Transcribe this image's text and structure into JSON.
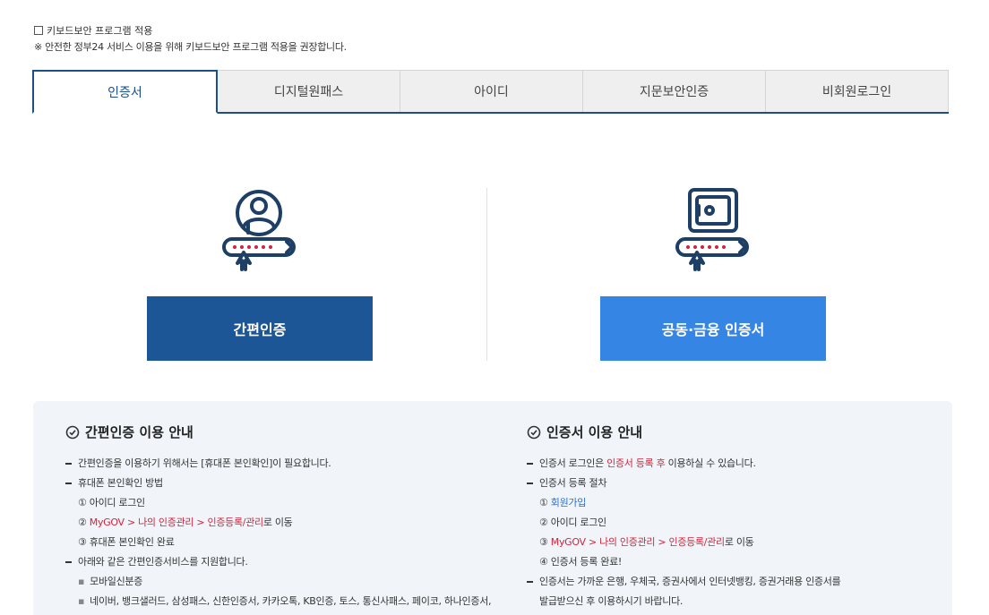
{
  "keyboard_security": {
    "checkbox_label": "키보드보안 프로그램 적용",
    "note": "※ 안전한 정부24 서비스 이용을 위해 키보드보안 프로그램 적용을 권장합니다."
  },
  "tabs": [
    {
      "label": "인증서",
      "active": true
    },
    {
      "label": "디지털원패스",
      "active": false
    },
    {
      "label": "아이디",
      "active": false
    },
    {
      "label": "지문보안인증",
      "active": false
    },
    {
      "label": "비회원로그인",
      "active": false
    }
  ],
  "login_options": {
    "simple_auth_button": "간편인증",
    "cert_button": "공동·금융 인증서"
  },
  "colors": {
    "primary": "#1c5696",
    "cert_button": "#3585e4",
    "highlight": "#d2233c"
  },
  "guide_simple": {
    "title": "간편인증 이용 안내",
    "item1": "간편인증을 이용하기 위해서는 [휴대폰 본인확인]이 필요합니다.",
    "item2": "휴대폰 본인확인 방법",
    "step1": "① 아이디 로그인",
    "step2_prefix": "② ",
    "step2_link": "MyGOV > 나의 인증관리 > 인증등록/관리",
    "step2_suffix": "로 이동",
    "step3": "③ 휴대폰 본인확인 완료",
    "item3": "아래와 같은 간편인증서비스를 지원합니다.",
    "sub1": "모바일신분증",
    "sub2": "네이버, 뱅크샐러드, 삼성패스, 신한인증서, 카카오톡, KB인증, 토스, 통신사패스, 페이코, 하나인증서,"
  },
  "guide_cert": {
    "title": "인증서 이용 안내",
    "item1_prefix": "인증서 로그인은 ",
    "item1_highlight": "인증서 등록 후",
    "item1_suffix": " 이용하실 수 있습니다.",
    "item2": "인증서 등록 절차",
    "step1_prefix": "① ",
    "step1_link": "회원가입",
    "step2": "② 아이디 로그인",
    "step3_prefix": "③ ",
    "step3_link": "MyGOV > 나의 인증관리 > 인증등록/관리",
    "step3_suffix": "로 이동",
    "step4": "④ 인증서 등록 완료!",
    "item3_line1": "인증서는 가까운 은행, 우체국, 증권사에서 인터넷뱅킹, 증권거래용 인증서를",
    "item3_line2": "발급받으신 후 이용하시기 바랍니다."
  }
}
